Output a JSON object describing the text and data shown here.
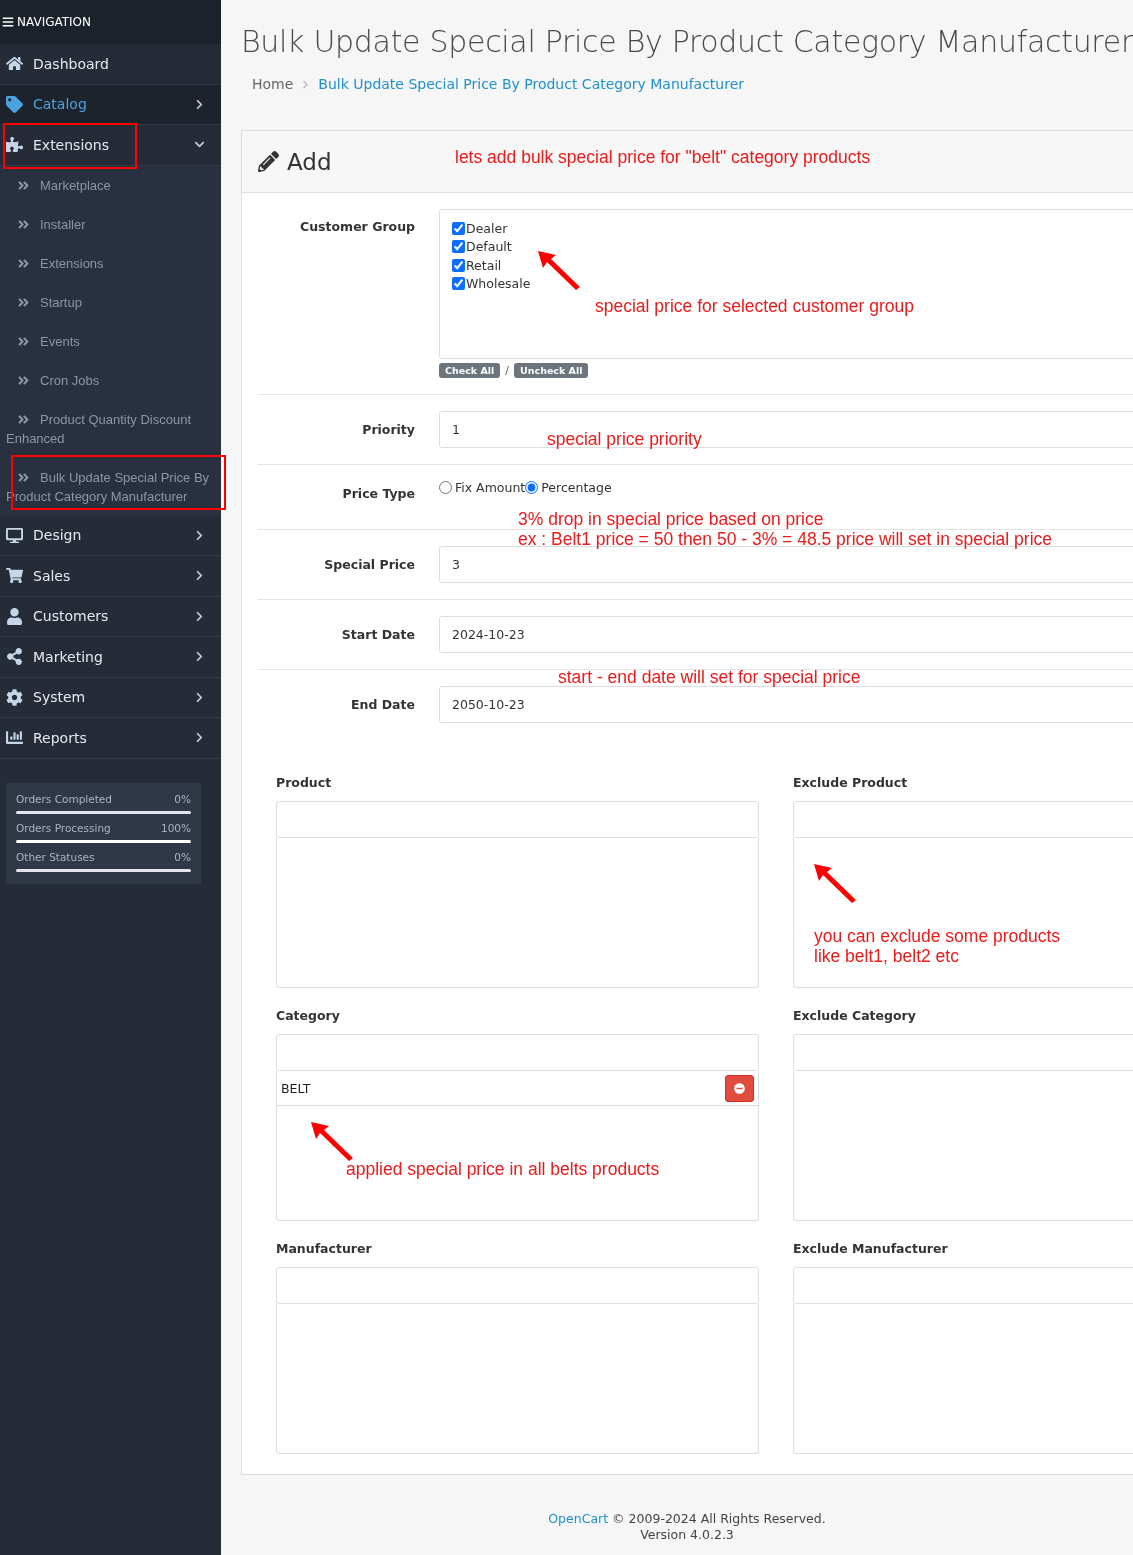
{
  "sidebar": {
    "header": "NAVIGATION",
    "items": [
      {
        "label": "Dashboard",
        "selected": false,
        "highlighted": false
      },
      {
        "label": "Catalog",
        "selected": true,
        "expanded": false,
        "highlighted": false
      },
      {
        "label": "Extensions",
        "selected": false,
        "expanded": true,
        "highlighted": true,
        "children": [
          {
            "label": "Marketplace",
            "highlighted": false
          },
          {
            "label": "Installer",
            "highlighted": false
          },
          {
            "label": "Extensions",
            "highlighted": false
          },
          {
            "label": "Startup",
            "highlighted": false
          },
          {
            "label": "Events",
            "highlighted": false
          },
          {
            "label": "Cron Jobs",
            "highlighted": false
          },
          {
            "label": "Product Quantity Discount Enhanced",
            "highlighted": false
          },
          {
            "label": "Bulk Update Special Price By Product Category Manufacturer",
            "highlighted": true
          }
        ]
      },
      {
        "label": "Design",
        "selected": false,
        "expanded": false,
        "highlighted": false
      },
      {
        "label": "Sales",
        "selected": false,
        "expanded": false,
        "highlighted": false
      },
      {
        "label": "Customers",
        "selected": false,
        "expanded": false,
        "highlighted": false
      },
      {
        "label": "Marketing",
        "selected": false,
        "expanded": false,
        "highlighted": false
      },
      {
        "label": "System",
        "selected": false,
        "expanded": false,
        "highlighted": false
      },
      {
        "label": "Reports",
        "selected": false,
        "expanded": false,
        "highlighted": false
      }
    ],
    "stats": [
      {
        "label": "Orders Completed",
        "value": "0%",
        "level": 0
      },
      {
        "label": "Orders Processing",
        "value": "100%",
        "level": 1
      },
      {
        "label": "Other Statuses",
        "value": "0%",
        "level": 0
      }
    ]
  },
  "page": {
    "title": "Bulk Update Special Price By Product Category Manufacturer",
    "breadcrumb": [
      {
        "label": "Home"
      },
      {
        "label": "Bulk Update Special Price By Product Category Manufacturer"
      }
    ]
  },
  "panel": {
    "title": "Add",
    "customer_group": {
      "label": "Customer Group",
      "options": [
        {
          "label": "Dealer",
          "checked": true
        },
        {
          "label": "Default",
          "checked": true
        },
        {
          "label": "Retail",
          "checked": true
        },
        {
          "label": "Wholesale",
          "checked": true
        }
      ],
      "check_all": "Check All",
      "separator": "/",
      "uncheck_all": "Uncheck All"
    },
    "priority": {
      "label": "Priority",
      "value": "1"
    },
    "price_type": {
      "label": "Price Type",
      "options": [
        {
          "label": "Fix Amount",
          "selected": false
        },
        {
          "label": "Percentage",
          "selected": true
        }
      ]
    },
    "special_price": {
      "label": "Special Price",
      "value": "3"
    },
    "start_date": {
      "label": "Start Date",
      "value": "2024-10-23"
    },
    "end_date": {
      "label": "End Date",
      "value": "2050-10-23"
    },
    "lists": [
      {
        "label": "Product"
      },
      {
        "label": "Exclude Product"
      },
      {
        "label": "Category",
        "items": [
          "BELT"
        ]
      },
      {
        "label": "Exclude Category"
      },
      {
        "label": "Manufacturer"
      },
      {
        "label": "Exclude Manufacturer"
      }
    ]
  },
  "annotations": [
    {
      "lines": [
        "lets add bulk special price for \"belt\" category products"
      ]
    },
    {
      "lines": [
        "special price for selected customer group"
      ]
    },
    {
      "lines": [
        "special price priority"
      ]
    },
    {
      "lines": [
        "3% drop in special price based on price",
        "ex : Belt1 price = 50 then 50 - 3% = 48.5 price will set in special price"
      ]
    },
    {
      "lines": [
        "start - end date will set for special price"
      ]
    },
    {
      "lines": [
        "you can exclude some products",
        "like belt1, belt2 etc"
      ]
    },
    {
      "lines": [
        "applied special price in all belts products"
      ]
    }
  ],
  "footer": {
    "link": "OpenCart",
    "text": "© 2009-2024 All Rights Reserved.",
    "version": "Version 4.0.2.3"
  }
}
